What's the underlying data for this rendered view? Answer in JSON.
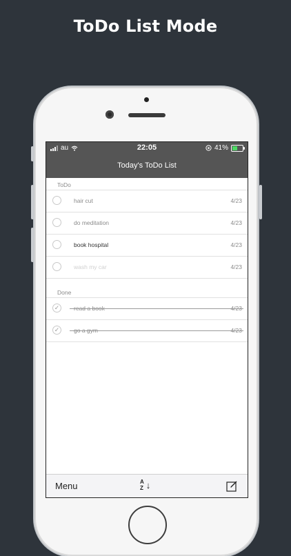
{
  "headline": "ToDo List Mode",
  "status_bar": {
    "carrier": "au",
    "time": "22:05",
    "battery_pct": "41%"
  },
  "nav_title": "Today's ToDo List",
  "todo_section": {
    "label": "ToDo",
    "items": [
      {
        "title": "hair cut",
        "date": "4/23"
      },
      {
        "title": "do meditation",
        "date": "4/23"
      },
      {
        "title": "book hospital",
        "date": "4/23"
      },
      {
        "title": "wash my car",
        "date": "4/23"
      }
    ]
  },
  "done_section": {
    "label": "Done",
    "items": [
      {
        "title": "read a book",
        "date": "4/23"
      },
      {
        "title": "go a gym",
        "date": "4/23"
      }
    ]
  },
  "toolbar": {
    "menu_label": "Menu",
    "sort_top": "A",
    "sort_bottom": "Z",
    "sort_arrow": "↓"
  },
  "colors": {
    "background": "#2e343b",
    "nav": "#555555",
    "battery_fill": "#4cd964"
  }
}
